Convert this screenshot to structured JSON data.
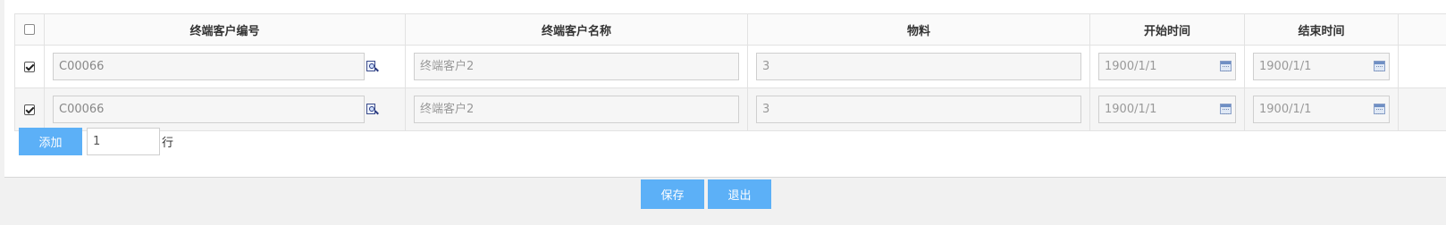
{
  "table": {
    "columns": {
      "code": "终端客户编号",
      "name": "终端客户名称",
      "material": "物料",
      "start": "开始时间",
      "end": "结束时间"
    },
    "rows": [
      {
        "checked": true,
        "code": "C00066",
        "name": "终端客户2",
        "material": "3",
        "start": "1900/1/1",
        "end": "1900/1/1"
      },
      {
        "checked": true,
        "code": "C00066",
        "name": "终端客户2",
        "material": "3",
        "start": "1900/1/1",
        "end": "1900/1/1"
      }
    ]
  },
  "add_bar": {
    "add_label": "添加",
    "count_value": "1",
    "unit_label": "行"
  },
  "footer": {
    "save_label": "保存",
    "exit_label": "退出"
  },
  "icons": {
    "lookup": "magnifier-lookup-icon",
    "calendar": "calendar-icon"
  },
  "colors": {
    "primary_button": "#5cb0f7"
  }
}
